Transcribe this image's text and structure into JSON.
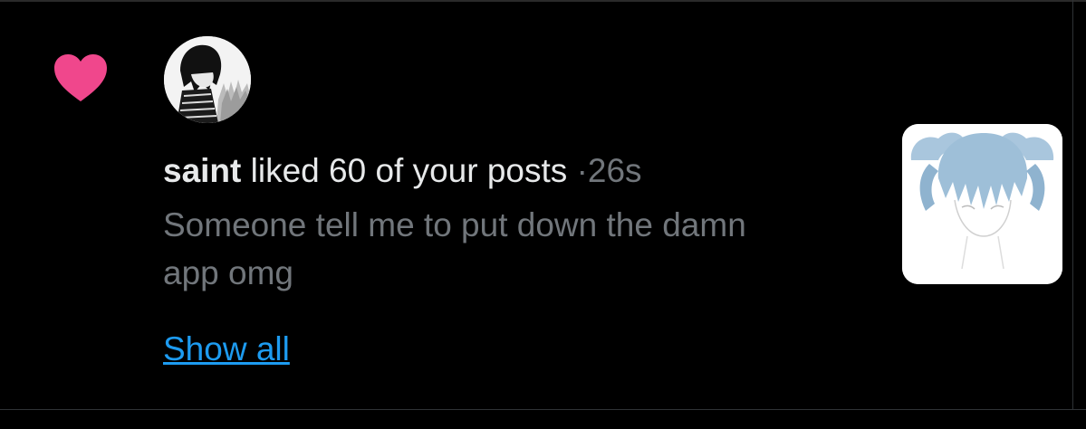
{
  "notification": {
    "username": "saint",
    "action_text": "liked 60 of your posts",
    "separator": "·",
    "timestamp": "26s",
    "post_snippet": "Someone tell me to put down the damn app omg",
    "show_all_label": "Show all"
  },
  "icons": {
    "type_icon": "heart-icon",
    "avatar": "user-avatar",
    "thumbnail": "post-thumbnail"
  },
  "colors": {
    "background": "#000000",
    "heart": "#f0478c",
    "primary_text": "#e7e9ea",
    "secondary_text": "#71767b",
    "link": "#1d9bf0"
  }
}
